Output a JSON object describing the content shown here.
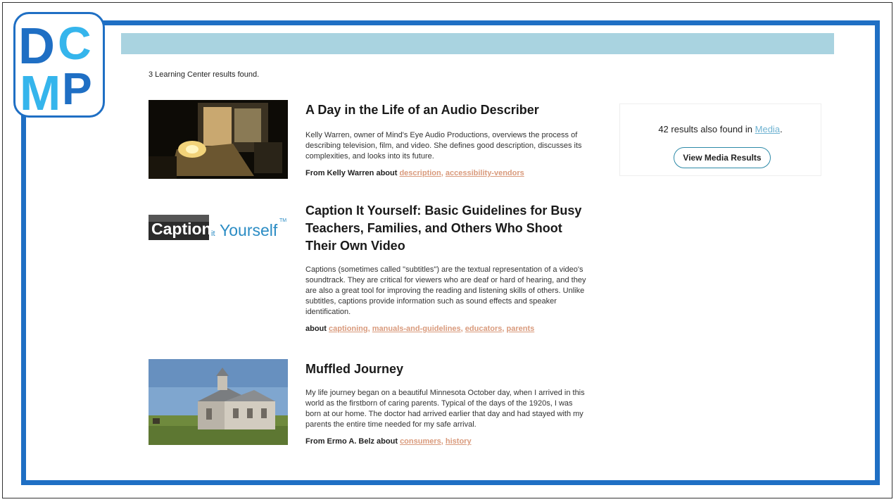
{
  "logo": {
    "letters": [
      "D",
      "C",
      "M",
      "P"
    ],
    "colors": {
      "dark_blue": "#1f6fc4",
      "light_blue": "#35b5ec"
    }
  },
  "results_summary": "3 Learning Center results found.",
  "results": [
    {
      "title": "A Day in the Life of an Audio Describer",
      "description": "Kelly Warren, owner of Mind's Eye Audio Productions, overviews the process of describing television, film, and video. She defines good description, discusses its complexities, and looks into its future.",
      "meta_prefix": "From Kelly Warren about",
      "tags": [
        "description",
        "accessibility-vendors"
      ],
      "thumbnail": "audio-describer-photo"
    },
    {
      "title": "Caption It Yourself: Basic Guidelines for Busy Teachers, Families, and Others Who Shoot Their Own Video",
      "description": "Captions (sometimes called \"subtitles\") are the textual representation of a video's soundtrack. They are critical for viewers who are deaf or hard of hearing, and they are also a great tool for improving the reading and listening skills of others. Unlike subtitles, captions provide information such as sound effects and speaker identification.",
      "meta_prefix": "about",
      "tags": [
        "captioning",
        "manuals-and-guidelines",
        "educators",
        "parents"
      ],
      "thumbnail": {
        "word1": "Caption",
        "word2": "it",
        "word3": "Yourself",
        "mark": "TM"
      }
    },
    {
      "title": "Muffled Journey",
      "description": "My life journey began on a beautiful Minnesota October day, when I arrived in this world as the firstborn of caring parents. Typical of the days of the 1920s, I was born at our home. The doctor had arrived earlier that day and had stayed with my parents the entire time needed for my safe arrival.",
      "meta_prefix": "From Ermo A. Belz about",
      "tags": [
        "consumers",
        "history"
      ],
      "thumbnail": "schoolhouse-photo"
    }
  ],
  "media_panel": {
    "text_before": "42 results also found in",
    "link": "Media",
    "text_after": ".",
    "button": "View Media Results"
  },
  "colors": {
    "frame": "#1f6fc4",
    "band": "#a9d3e0",
    "tag": "#d99a7c",
    "link": "#6fb3d2",
    "button_border": "#2d8aa8"
  }
}
